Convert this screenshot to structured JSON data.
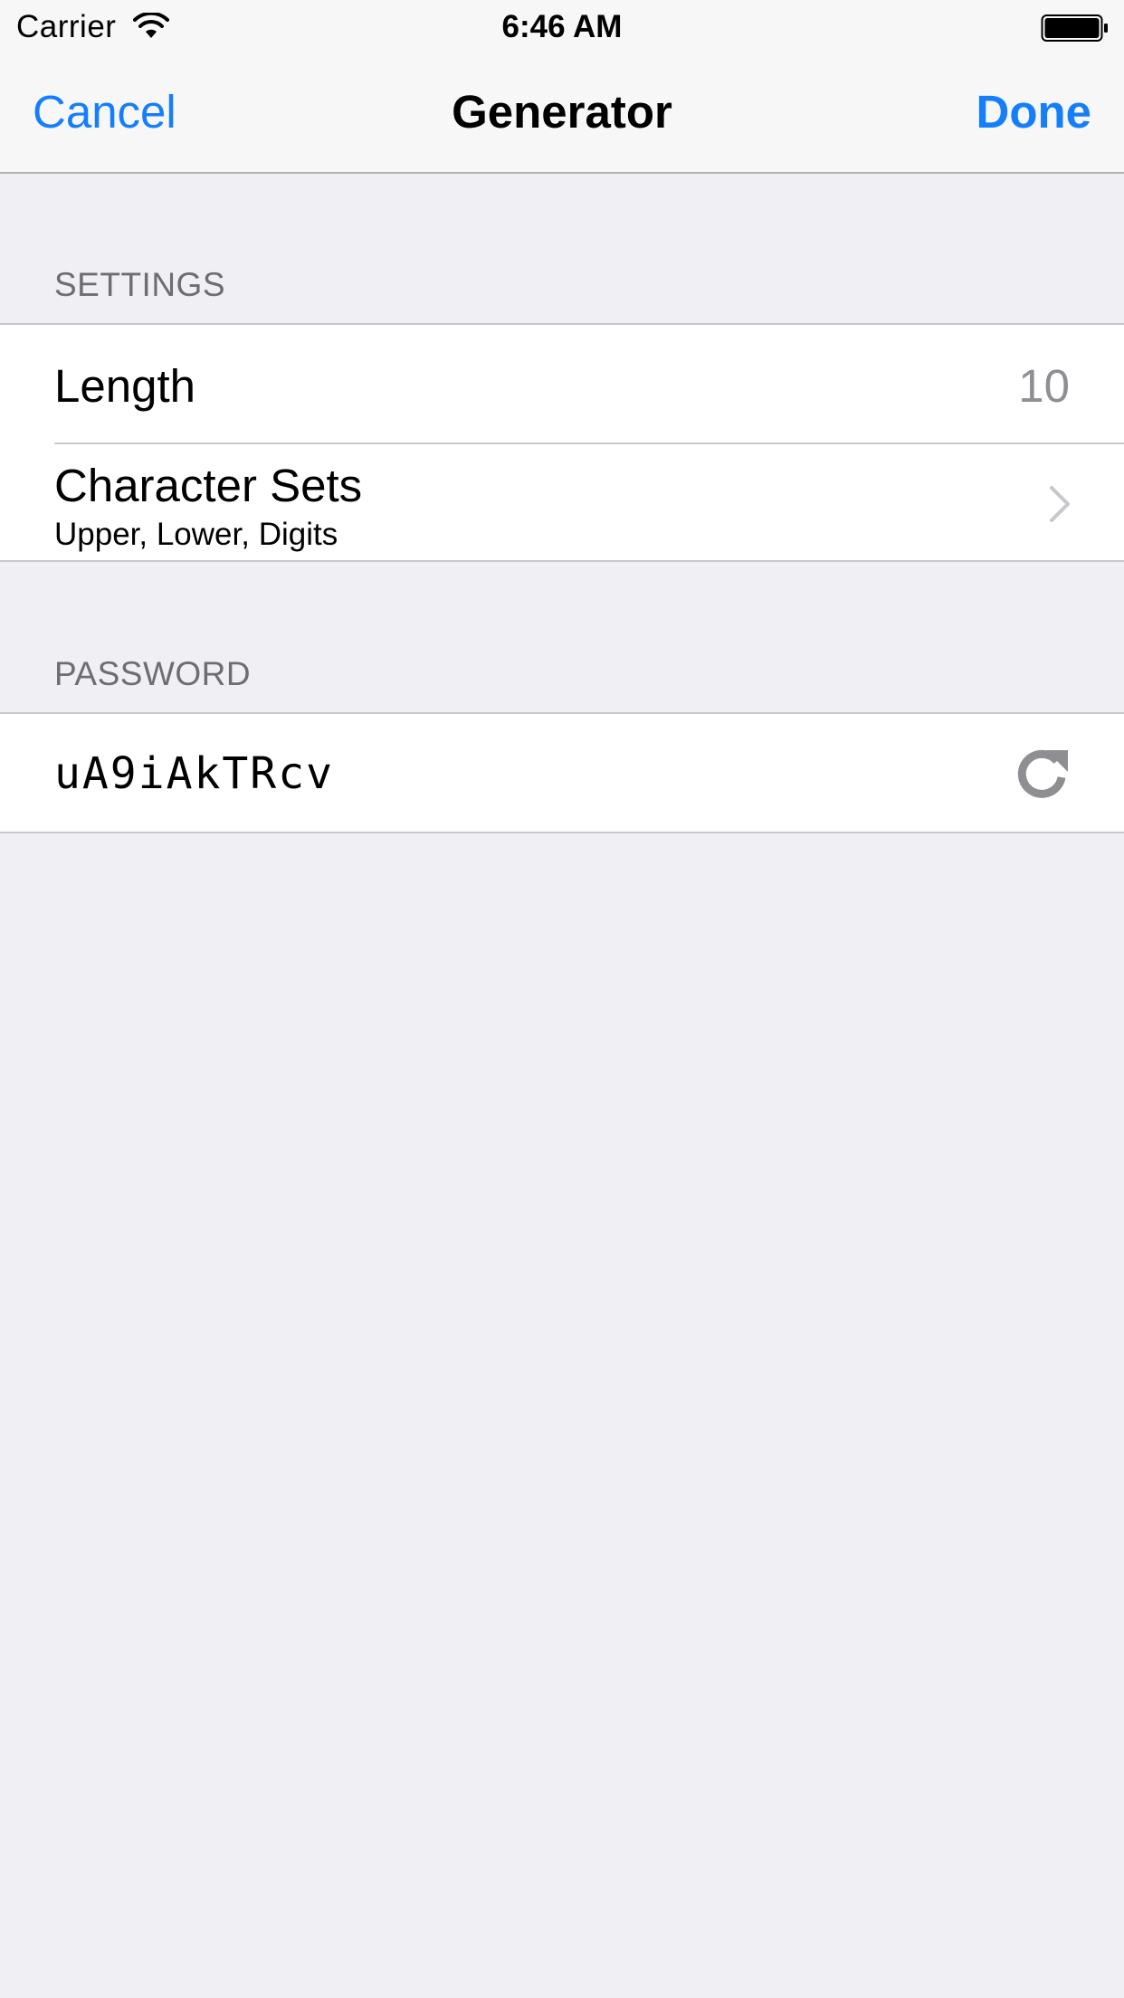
{
  "status_bar": {
    "carrier": "Carrier",
    "time": "6:46 AM",
    "wifi_icon": "wifi-icon",
    "battery_icon": "battery-icon"
  },
  "nav": {
    "cancel_label": "Cancel",
    "title": "Generator",
    "done_label": "Done",
    "accent_color": "#157EFB"
  },
  "settings": {
    "header": "SETTINGS",
    "length": {
      "label": "Length",
      "value": "10"
    },
    "character_sets": {
      "label": "Character Sets",
      "subtitle": "Upper, Lower, Digits",
      "accessory_icon": "chevron-right-icon"
    }
  },
  "password": {
    "header": "PASSWORD",
    "value": "uA9iAkTRcv",
    "action_icon": "refresh-icon"
  }
}
